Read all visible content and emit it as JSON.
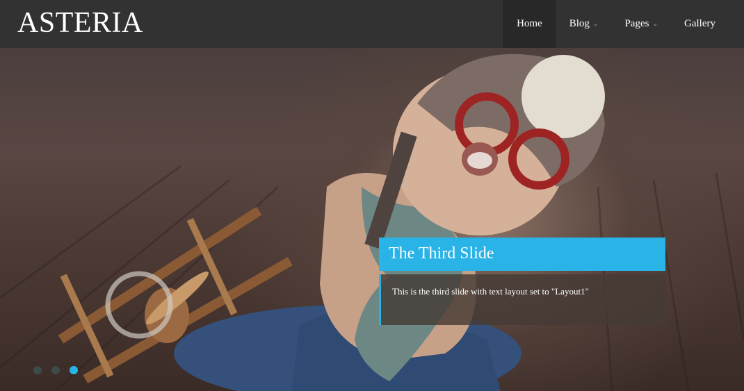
{
  "site": {
    "logo": "ASTERIA"
  },
  "nav": {
    "items": [
      {
        "label": "Home",
        "active": true,
        "has_dropdown": false
      },
      {
        "label": "Blog",
        "active": false,
        "has_dropdown": true
      },
      {
        "label": "Pages",
        "active": false,
        "has_dropdown": true
      },
      {
        "label": "Gallery",
        "active": false,
        "has_dropdown": false
      }
    ],
    "dropdown_icon": "chevron-down-icon"
  },
  "slider": {
    "caption_title": "The Third Slide",
    "caption_text": "This is the third slide with text layout set to \"Layout1\"",
    "slide_count": 3,
    "active_slide": 3
  },
  "colors": {
    "accent": "#29b3e6",
    "header_bg": "#333232",
    "nav_active_bg": "#292828"
  }
}
